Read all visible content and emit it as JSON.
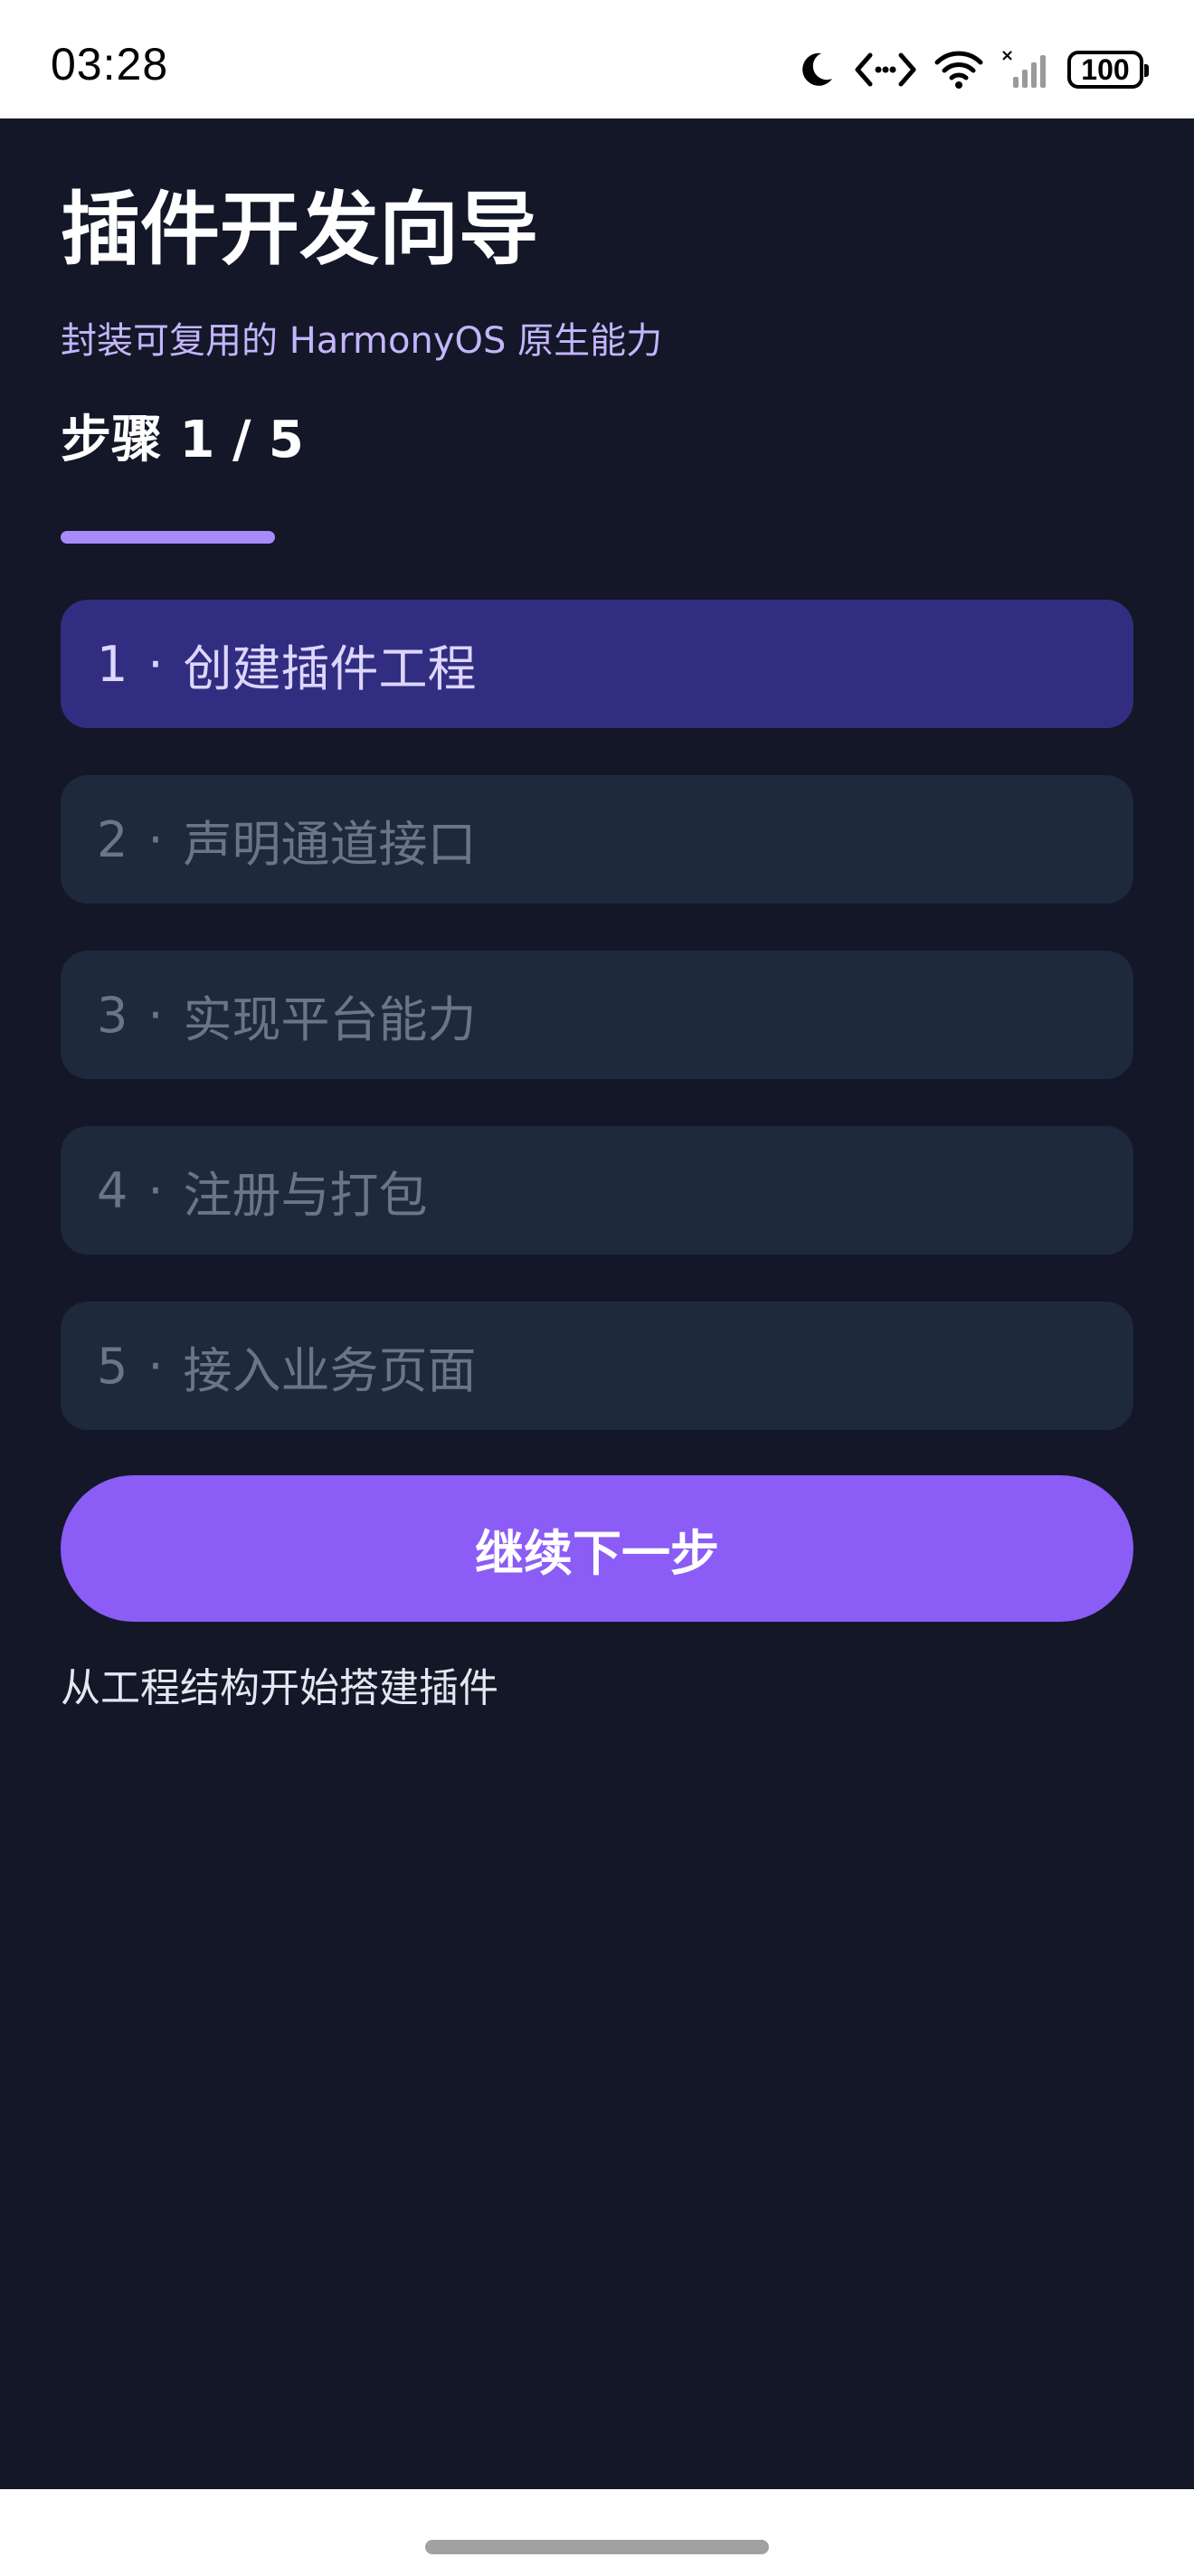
{
  "status_bar": {
    "time": "03:28",
    "battery": "100",
    "icons": [
      "moon-icon",
      "code-brackets-icon",
      "wifi-icon",
      "signal-no-sim-icon",
      "battery-icon"
    ]
  },
  "header": {
    "title": "插件开发向导",
    "subtitle": "封装可复用的 HarmonyOS 原生能力",
    "step_indicator": "步骤 1 / 5"
  },
  "progress": {
    "current_step": 1,
    "total_steps": 5,
    "fraction": 0.2
  },
  "steps": [
    {
      "num": "1",
      "label": "创建插件工程",
      "active": true
    },
    {
      "num": "2",
      "label": "声明通道接口",
      "active": false
    },
    {
      "num": "3",
      "label": "实现平台能力",
      "active": false
    },
    {
      "num": "4",
      "label": "注册与打包",
      "active": false
    },
    {
      "num": "5",
      "label": "接入业务页面",
      "active": false
    }
  ],
  "step_separator": "·",
  "actions": {
    "continue_label": "继续下一步"
  },
  "hint": "从工程结构开始搭建插件",
  "colors": {
    "background": "#131727",
    "card": "#1e293b",
    "card_active": "#312e81",
    "accent": "#8b5cf6",
    "progress": "#a78bfa",
    "subtitle": "#c4b5fd"
  }
}
